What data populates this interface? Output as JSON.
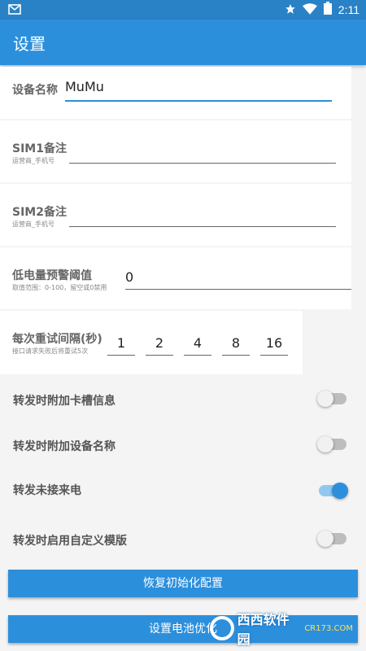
{
  "status_bar": {
    "left_icon": "message-icon",
    "time": "2:11",
    "icons": [
      "star-icon",
      "wifi-icon",
      "battery-icon"
    ]
  },
  "app_bar": {
    "title": "设置"
  },
  "device_name": {
    "label": "设备名称",
    "value": "MuMu"
  },
  "sim1": {
    "label": "SIM1备注",
    "hint": "运营商_手机号",
    "value": ""
  },
  "sim2": {
    "label": "SIM2备注",
    "hint": "运营商_手机号",
    "value": ""
  },
  "low_battery": {
    "label": "低电量预警阈值",
    "hint": "取值范围：0-100，留空或0禁用",
    "value": "0"
  },
  "retry": {
    "label": "每次重试间隔(秒)",
    "hint": "接口请求失败后将重试5次",
    "values": [
      "1",
      "2",
      "4",
      "8",
      "16"
    ]
  },
  "toggles": [
    {
      "label": "转发时附加卡槽信息",
      "on": false
    },
    {
      "label": "转发时附加设备名称",
      "on": false
    },
    {
      "label": "转发未接来电",
      "on": true
    },
    {
      "label": "转发时启用自定义模版",
      "on": false
    }
  ],
  "buttons": {
    "reset": "恢复初始化配置",
    "battery": "设置电池优化"
  },
  "watermark": {
    "brand": "西西软件园",
    "domain": "CR173.COM"
  },
  "colors": {
    "primary": "#2c8fdc",
    "status_bar": "#2a82c6",
    "toggle_on": "#2c8fdc"
  }
}
